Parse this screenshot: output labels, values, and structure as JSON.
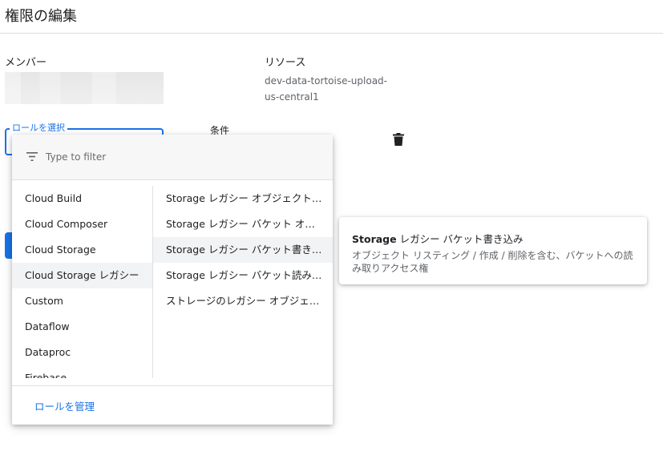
{
  "page": {
    "title": "権限の編集"
  },
  "member": {
    "label": "メンバー"
  },
  "resource": {
    "label": "リソース",
    "value": "dev-data-tortoise-upload-us-central1"
  },
  "role_field": {
    "label": "ロールを選択"
  },
  "condition": {
    "label": "条件"
  },
  "dropdown": {
    "filter_placeholder": "Type to filter",
    "categories": [
      {
        "label": "Cloud Build"
      },
      {
        "label": "Cloud Composer"
      },
      {
        "label": "Cloud Storage"
      },
      {
        "label": "Cloud Storage レガシー"
      },
      {
        "label": "Custom"
      },
      {
        "label": "Dataflow"
      },
      {
        "label": "Dataproc"
      },
      {
        "label": "Firebase"
      }
    ],
    "roles": [
      {
        "label": "Storage レガシー オブジェクト読み取り"
      },
      {
        "label": "Storage レガシー バケット オーナー"
      },
      {
        "label": "Storage レガシー バケット書き込み"
      },
      {
        "label": "Storage レガシー バケット読み取り"
      },
      {
        "label": "ストレージのレガシー オブジェクト オーナー"
      }
    ],
    "manage_label": "ロールを管理"
  },
  "tooltip": {
    "title_prefix": "Storage",
    "title_rest": " レガシー バケット書き込み",
    "description": "オブジェクト リスティング / 作成 / 削除を含む、バケットへの読み取りアクセス権"
  },
  "colors": {
    "accent": "#1a73e8",
    "hover_bg": "#f1f3f4"
  }
}
